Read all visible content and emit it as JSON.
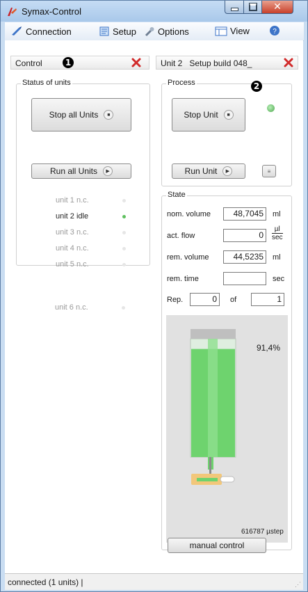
{
  "window": {
    "title": "Symax-Control"
  },
  "menu": {
    "connection": "Connection",
    "setup": "Setup",
    "options": "Options",
    "view": "View"
  },
  "control_panel": {
    "title": "Control",
    "badge": "1",
    "status_group": "Status of units",
    "stop_all": "Stop all Units",
    "run_all": "Run all Units",
    "units": [
      {
        "name": "unit 1",
        "state": "n.c."
      },
      {
        "name": "unit 2",
        "state": "idle"
      },
      {
        "name": "unit 3",
        "state": "n.c."
      },
      {
        "name": "unit 4",
        "state": "n.c."
      },
      {
        "name": "unit 5",
        "state": "n.c."
      },
      {
        "name": "unit 6",
        "state": "n.c."
      }
    ]
  },
  "unit_panel": {
    "title": "Unit 2   Setup build 048_",
    "badge": "2",
    "process_group": "Process",
    "stop_unit": "Stop Unit",
    "run_unit": "Run Unit",
    "state_group": "State",
    "nom_volume_label": "nom. volume",
    "nom_volume": "48,7045",
    "nom_volume_unit": "ml",
    "act_flow_label": "act. flow",
    "act_flow": "0",
    "act_flow_unit_num": "µl",
    "act_flow_unit_den": "sec",
    "rem_volume_label": "rem. volume",
    "rem_volume": "44,5235",
    "rem_volume_unit": "ml",
    "rem_time_label": "rem. time",
    "rem_time": "",
    "rem_time_unit": "sec",
    "rep_label": "Rep.",
    "rep_value": "0",
    "of_label": "of",
    "rep_total": "1",
    "fill_percent": "91,4%",
    "fill_fraction": 0.914,
    "steps": "616787 µstep",
    "manual_control": "manual control"
  },
  "status": {
    "text": "connected (1 units)  |"
  }
}
